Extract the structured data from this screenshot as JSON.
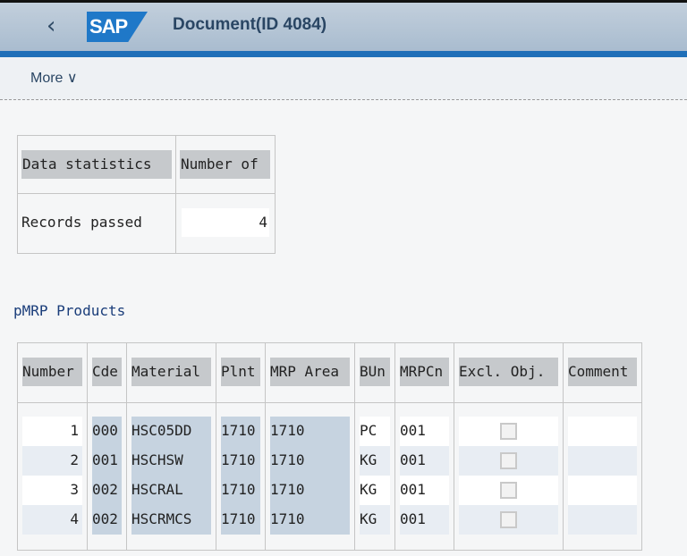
{
  "header": {
    "title": "Document(ID 4084)",
    "logo": "SAP",
    "back_icon": "chevron-left-icon"
  },
  "toolbar": {
    "more_label": "More ∨"
  },
  "stats": {
    "headers": [
      "Data statistics",
      "Number of"
    ],
    "row": {
      "label": "Records passed",
      "value": "4"
    }
  },
  "products": {
    "title": "pMRP Products",
    "columns": [
      "Number",
      "Cde",
      "Material",
      "Plnt",
      "MRP Area",
      "BUn",
      "MRPCn",
      "Excl. Obj.",
      "Comment"
    ],
    "rows": [
      {
        "number": "1",
        "cde": "000",
        "material": "HSC05DD",
        "plnt": "1710",
        "area": "1710",
        "bun": "PC",
        "mrpcn": "001",
        "excl": false,
        "comment": ""
      },
      {
        "number": "2",
        "cde": "001",
        "material": "HSCHSW",
        "plnt": "1710",
        "area": "1710",
        "bun": "KG",
        "mrpcn": "001",
        "excl": false,
        "comment": ""
      },
      {
        "number": "3",
        "cde": "002",
        "material": "HSCRAL",
        "plnt": "1710",
        "area": "1710",
        "bun": "KG",
        "mrpcn": "001",
        "excl": false,
        "comment": ""
      },
      {
        "number": "4",
        "cde": "002",
        "material": "HSCRMCS",
        "plnt": "1710",
        "area": "1710",
        "bun": "KG",
        "mrpcn": "001",
        "excl": false,
        "comment": ""
      }
    ]
  }
}
